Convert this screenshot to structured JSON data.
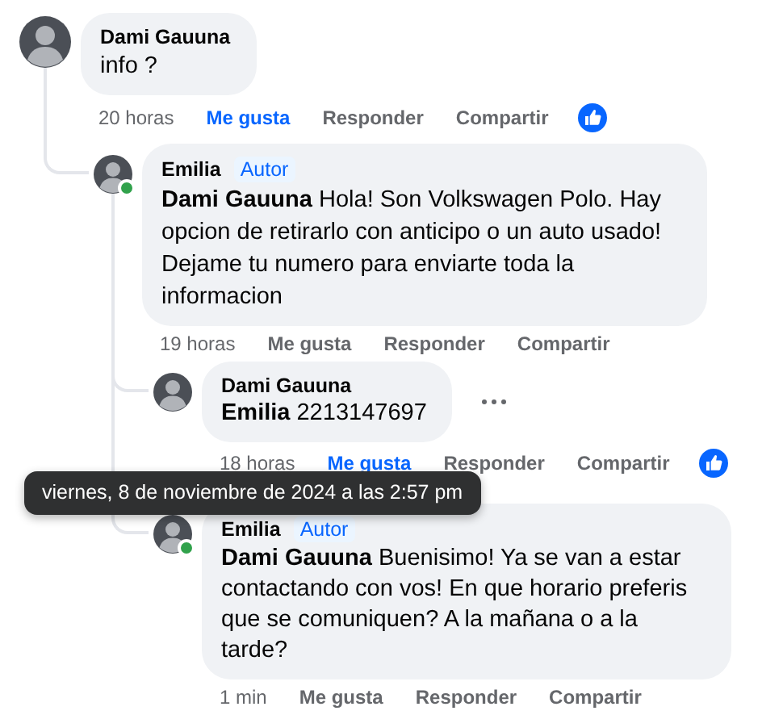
{
  "comments": [
    {
      "author": "Dami Gauuna",
      "text": "info ?",
      "time": "20 horas",
      "time_hovered": false,
      "like_label": "Me gusta",
      "liked": true,
      "reply_label": "Responder",
      "share_label": "Compartir",
      "reactions": true,
      "online": false,
      "more_menu": false,
      "children": [
        {
          "author": "Emilia",
          "badge": "Autor",
          "text": "**Dami Gauuna** Hola! Son Volkswagen Polo. Hay opcion de retirarlo con anticipo o un auto usado! Dejame tu numero para enviarte toda la informacion",
          "time": "19 horas",
          "time_hovered": false,
          "like_label": "Me gusta",
          "liked": false,
          "reply_label": "Responder",
          "share_label": "Compartir",
          "reactions": false,
          "online": true,
          "more_menu": false,
          "children": [
            {
              "author": "Dami Gauuna",
              "text": "**Emilia** 2213147697",
              "time": "18 horas",
              "time_hovered": true,
              "like_label": "Me gusta",
              "liked": true,
              "reply_label": "Responder",
              "share_label": "Compartir",
              "reactions": true,
              "online": false,
              "more_menu": true
            },
            {
              "author": "Emilia",
              "badge": "Autor",
              "text": "**Dami Gauuna** Buenisimo! Ya se van a estar contactando con vos! En que horario preferis que se comuniquen? A la mañana o a la tarde?",
              "time": "1 min",
              "time_hovered": false,
              "like_label": "Me gusta",
              "liked": false,
              "reply_label": "Responder",
              "share_label": "Compartir",
              "reactions": false,
              "online": true,
              "more_menu": false
            }
          ]
        }
      ]
    }
  ],
  "tooltip": {
    "text": "viernes, 8 de noviembre de 2024 a las 2:57 pm"
  }
}
